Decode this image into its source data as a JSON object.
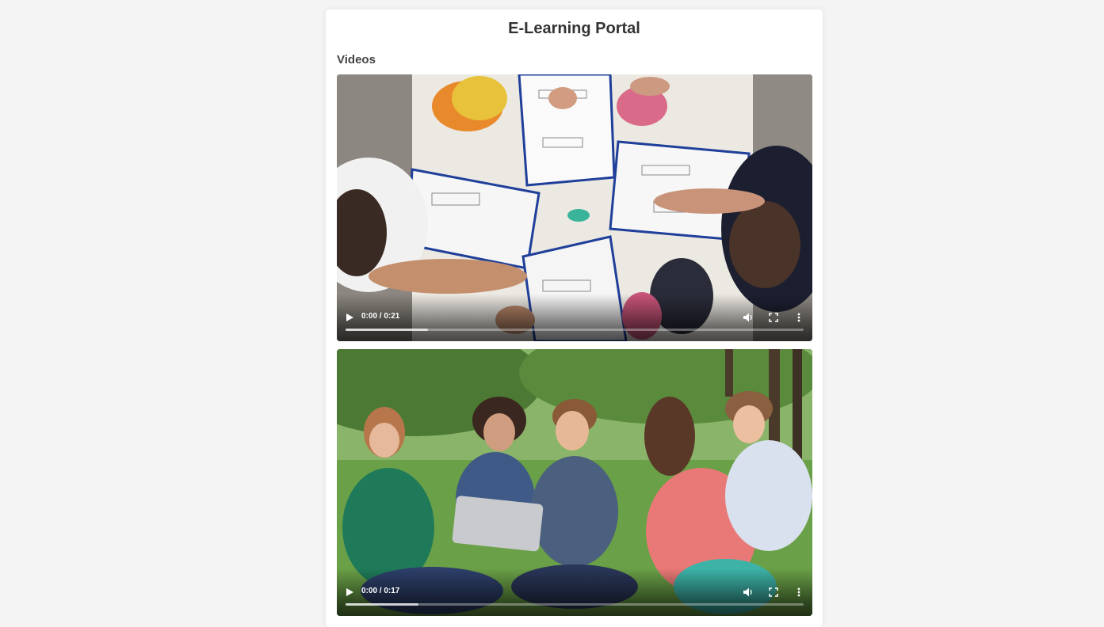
{
  "page": {
    "title": "E-Learning Portal",
    "section_heading": "Videos"
  },
  "videos": [
    {
      "time_display": "0:00 / 0:21",
      "buffered_fraction": 0.18,
      "controls": [
        "play-icon",
        "volume-icon",
        "fullscreen-icon",
        "more-options-icon"
      ]
    },
    {
      "time_display": "0:00 / 0:17",
      "buffered_fraction": 0.16,
      "controls": [
        "play-icon",
        "volume-icon",
        "fullscreen-icon",
        "more-options-icon"
      ]
    }
  ],
  "colors": {
    "page_background": "#f4f4f4",
    "card_background": "#ffffff",
    "title_text": "#333333"
  }
}
